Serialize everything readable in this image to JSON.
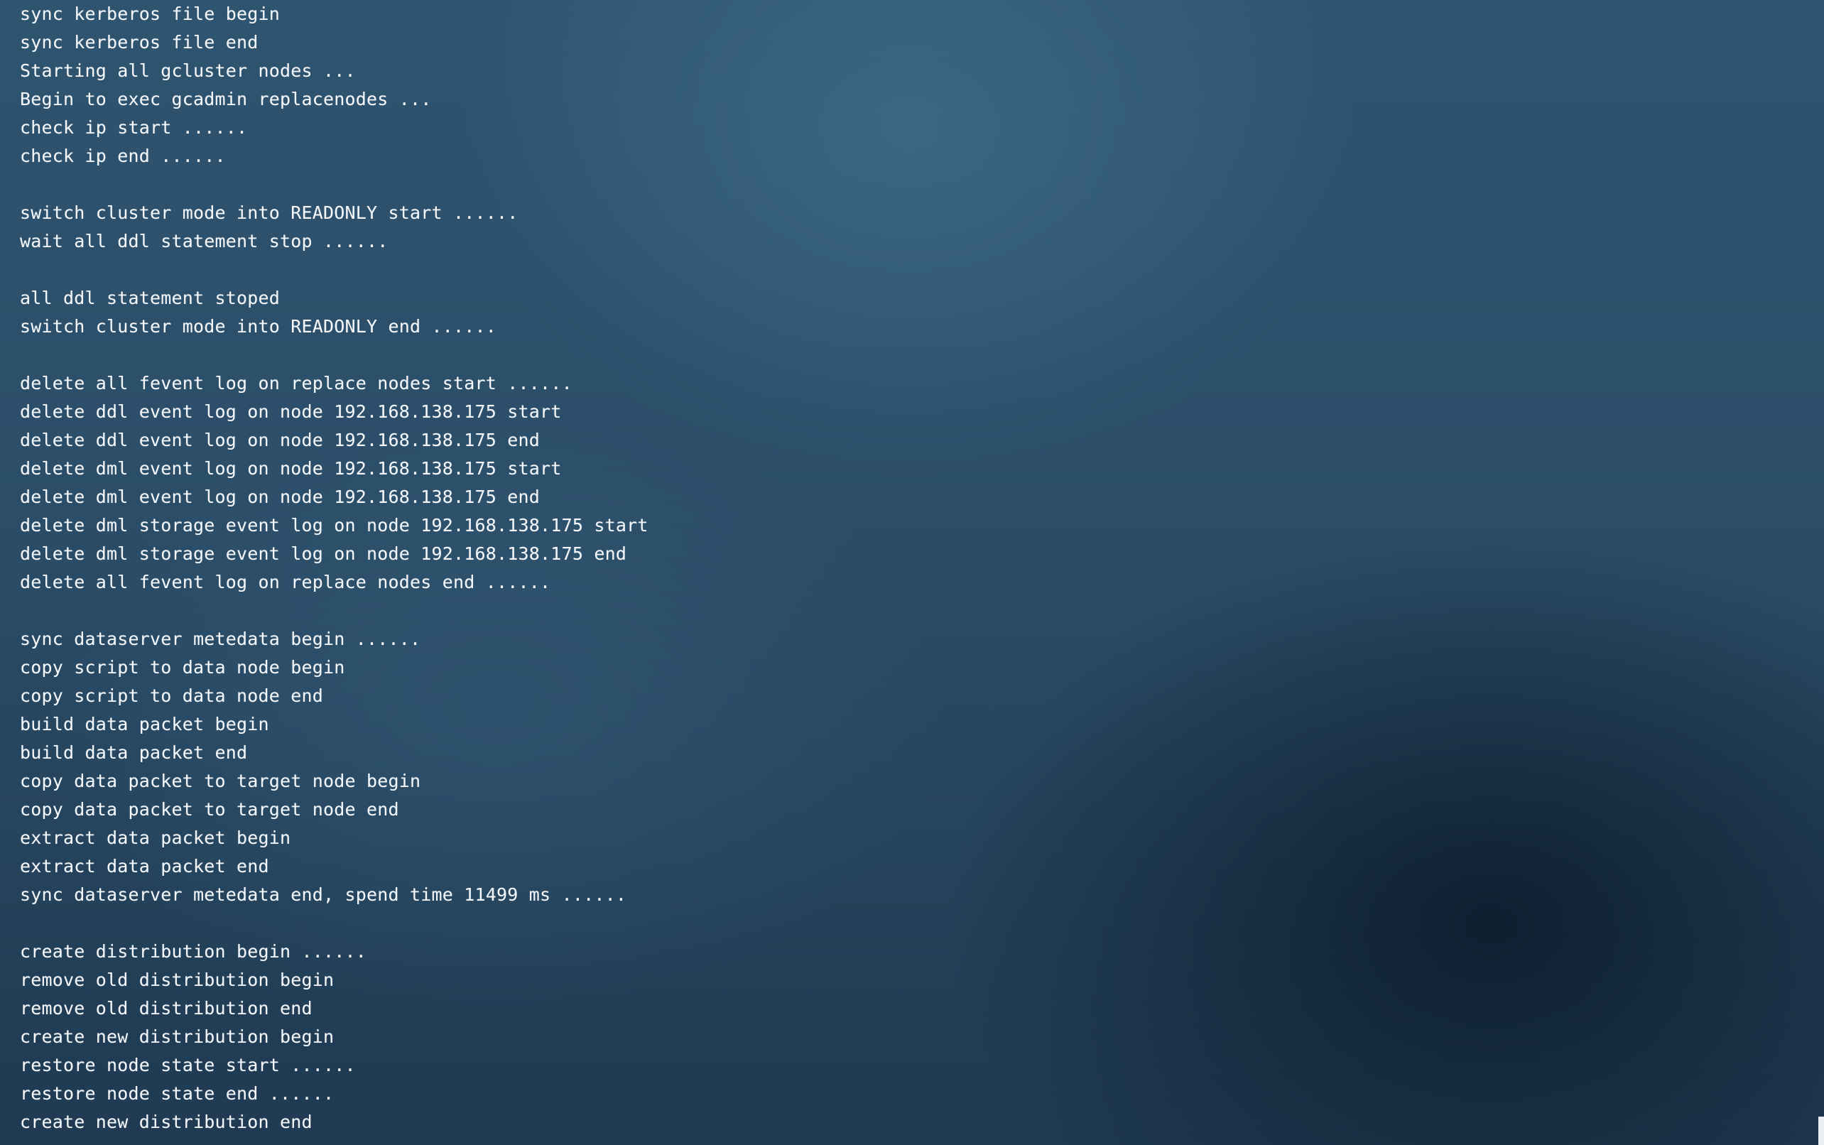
{
  "terminal": {
    "lines": [
      "sync kerberos file begin",
      "sync kerberos file end",
      "Starting all gcluster nodes ...",
      "Begin to exec gcadmin replacenodes ...",
      "check ip start ......",
      "check ip end ......",
      "",
      "switch cluster mode into READONLY start ......",
      "wait all ddl statement stop ......",
      "",
      "all ddl statement stoped",
      "switch cluster mode into READONLY end ......",
      "",
      "delete all fevent log on replace nodes start ......",
      "delete ddl event log on node 192.168.138.175 start",
      "delete ddl event log on node 192.168.138.175 end",
      "delete dml event log on node 192.168.138.175 start",
      "delete dml event log on node 192.168.138.175 end",
      "delete dml storage event log on node 192.168.138.175 start",
      "delete dml storage event log on node 192.168.138.175 end",
      "delete all fevent log on replace nodes end ......",
      "",
      "sync dataserver metedata begin ......",
      "copy script to data node begin",
      "copy script to data node end",
      "build data packet begin",
      "build data packet end",
      "copy data packet to target node begin",
      "copy data packet to target node end",
      "extract data packet begin",
      "extract data packet end",
      "sync dataserver metedata end, spend time 11499 ms ......",
      "",
      "create distribution begin ......",
      "remove old distribution begin",
      "remove old distribution end",
      "create new distribution begin",
      "restore node state start ......",
      "restore node state end ......",
      "create new distribution end"
    ]
  }
}
